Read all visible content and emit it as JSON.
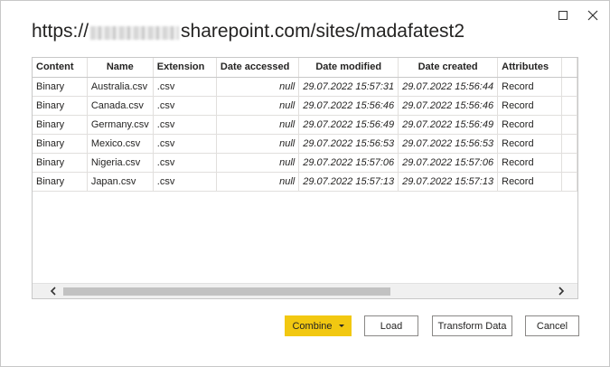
{
  "dialog": {
    "title_prefix": "https://",
    "title_suffix": "sharepoint.com/sites/madafatest2",
    "window_controls": {
      "maximize_icon": "maximize-icon",
      "close_icon": "close-icon"
    }
  },
  "table": {
    "columns": [
      "Content",
      "Name",
      "Extension",
      "Date accessed",
      "Date modified",
      "Date created",
      "Attributes"
    ],
    "rows": [
      [
        "Binary",
        "Australia.csv",
        ".csv",
        "null",
        "29.07.2022 15:57:31",
        "29.07.2022 15:56:44",
        "Record"
      ],
      [
        "Binary",
        "Canada.csv",
        ".csv",
        "null",
        "29.07.2022 15:56:46",
        "29.07.2022 15:56:46",
        "Record"
      ],
      [
        "Binary",
        "Germany.csv",
        ".csv",
        "null",
        "29.07.2022 15:56:49",
        "29.07.2022 15:56:49",
        "Record"
      ],
      [
        "Binary",
        "Mexico.csv",
        ".csv",
        "null",
        "29.07.2022 15:56:53",
        "29.07.2022 15:56:53",
        "Record"
      ],
      [
        "Binary",
        "Nigeria.csv",
        ".csv",
        "null",
        "29.07.2022 15:57:06",
        "29.07.2022 15:57:06",
        "Record"
      ],
      [
        "Binary",
        "Japan.csv",
        ".csv",
        "null",
        "29.07.2022 15:57:13",
        "29.07.2022 15:57:13",
        "Record"
      ]
    ]
  },
  "buttons": {
    "combine": "Combine",
    "load": "Load",
    "transform": "Transform Data",
    "cancel": "Cancel"
  },
  "colors": {
    "accent": "#f2c811"
  }
}
